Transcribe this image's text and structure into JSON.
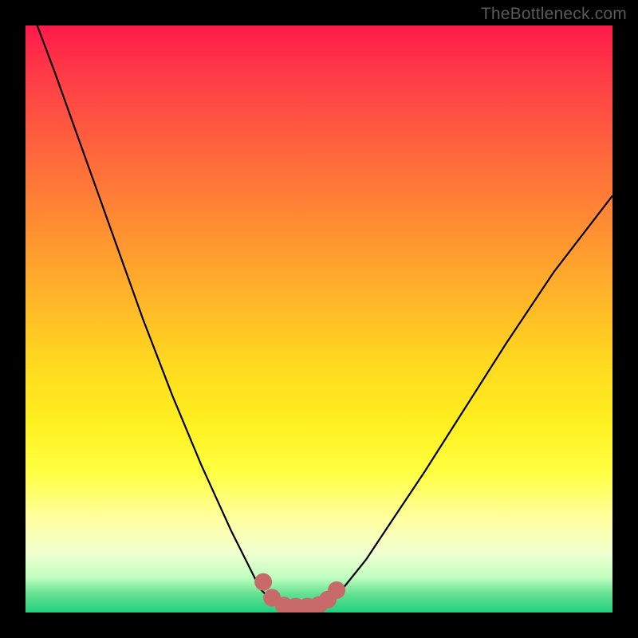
{
  "watermark": "TheBottleneck.com",
  "chart_data": {
    "type": "line",
    "title": "",
    "xlabel": "",
    "ylabel": "",
    "xlim": [
      0,
      100
    ],
    "ylim": [
      0,
      100
    ],
    "grid": false,
    "series": [
      {
        "name": "bottleneck-curve",
        "x": [
          2,
          5,
          10,
          15,
          20,
          25,
          30,
          35,
          38,
          40,
          42,
          44,
          46,
          48,
          50,
          52,
          54,
          58,
          62,
          68,
          75,
          82,
          90,
          100
        ],
        "y": [
          100,
          92,
          78,
          64,
          50,
          37,
          25,
          14,
          8,
          4,
          2,
          1,
          1,
          1,
          1,
          2,
          4,
          9,
          15,
          24,
          35,
          46,
          58,
          71
        ],
        "color": "#000000"
      }
    ],
    "markers": {
      "name": "highlight-dots",
      "x": [
        40.5,
        42,
        44,
        46,
        48,
        50,
        51.5,
        53
      ],
      "y": [
        5.2,
        2.5,
        1.2,
        1,
        1,
        1.3,
        2.2,
        3.8
      ],
      "color": "#c96a6a",
      "size": 10
    },
    "colors": {
      "gradient_top": "#ff1a4a",
      "gradient_mid": "#ffda1f",
      "gradient_bottom": "#20d080",
      "frame": "#000000"
    }
  }
}
